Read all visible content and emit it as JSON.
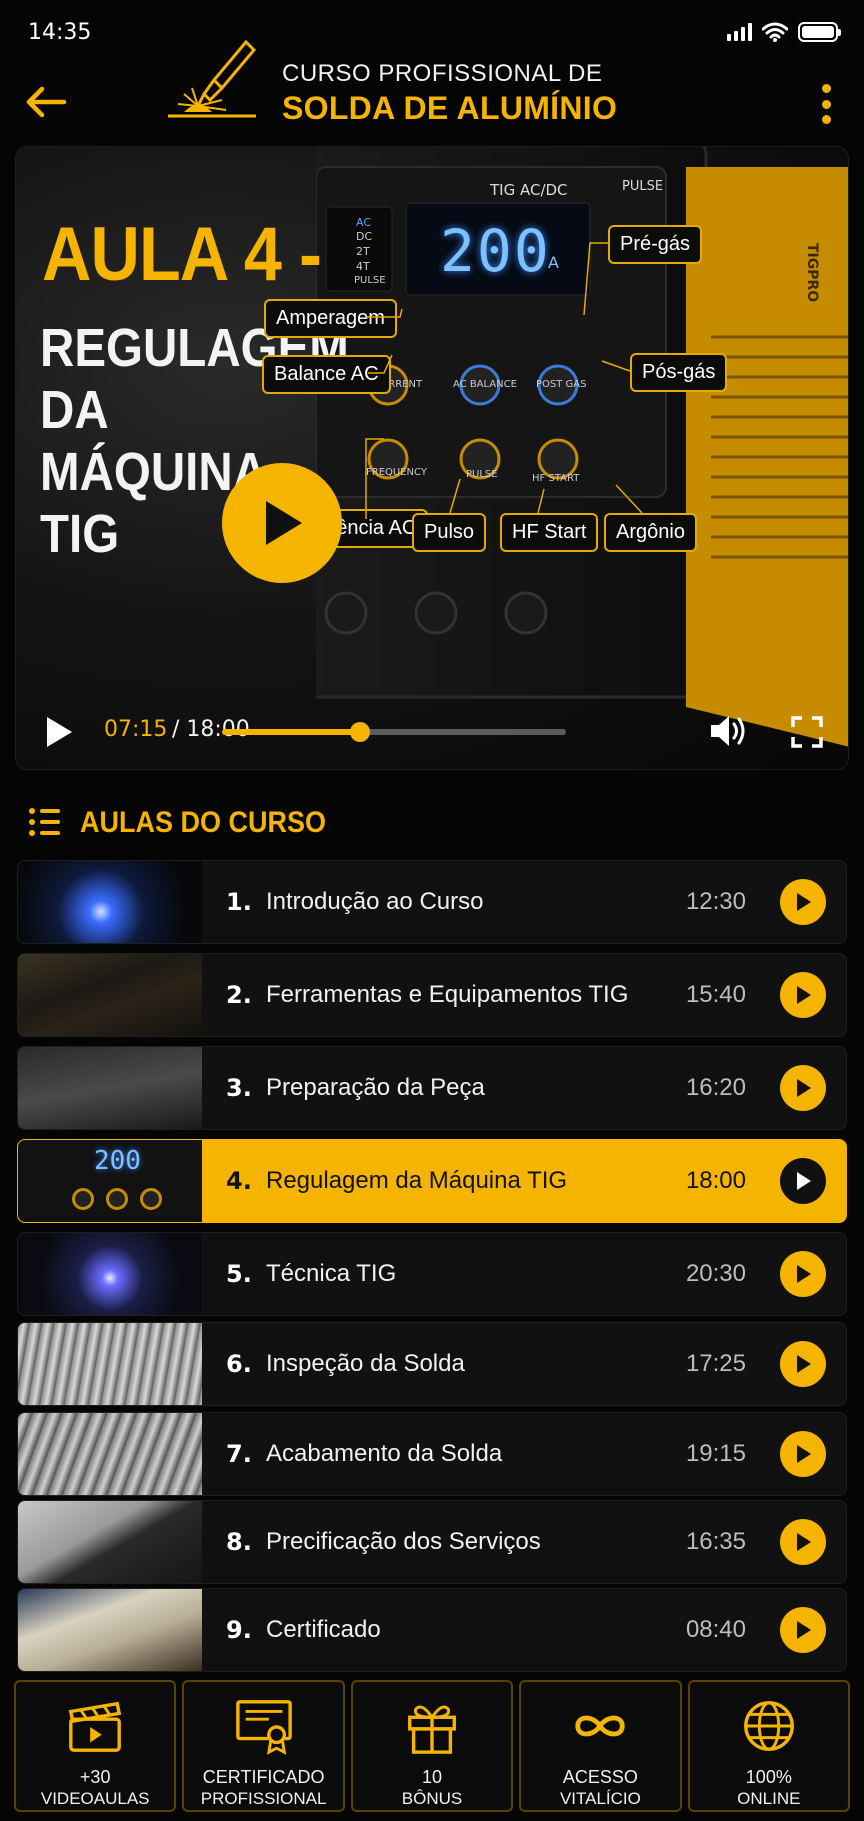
{
  "status_bar": {
    "time": "14:35"
  },
  "header": {
    "title_line1": "CURSO PROFISSIONAL DE",
    "title_line2": "SOLDA DE ALUMÍNIO",
    "back_icon": "arrow-left-icon",
    "menu_icon": "more-vertical-icon"
  },
  "video": {
    "lesson_heading": "AULA 4 -",
    "lesson_subtitle": "REGULAGEM DA MÁQUINA TIG",
    "current_time": "07:15",
    "total_time": "/ 18:00",
    "progress_percent": 40,
    "machine": {
      "mode_label": "TIG AC/DC",
      "pulse_label": "PULSE",
      "display_value": "200",
      "display_unit": "A",
      "left_panel": [
        "AC",
        "DC",
        "2T",
        "4T",
        "PULSE"
      ],
      "knobs": [
        "CURRENT",
        "AC BALANCE",
        "POST GAS",
        "FREQUENCY",
        "PULSE",
        "HF START"
      ],
      "brand": "TIGPRO"
    },
    "callouts": {
      "amperagem": "Amperagem",
      "balance_ac": "Balance AC",
      "pre_gas": "Pré-gás",
      "pos_gas": "Pós-gás",
      "frequencia_ac": "Frequência AC",
      "pulso": "Pulso",
      "hf_start": "HF Start",
      "argonio": "Argônio"
    }
  },
  "course_list": {
    "title": "AULAS DO CURSO",
    "lessons": [
      {
        "num": "1.",
        "title": "Introdução ao Curso",
        "duration": "12:30"
      },
      {
        "num": "2.",
        "title": "Ferramentas e Equipamentos TIG",
        "duration": "15:40"
      },
      {
        "num": "3.",
        "title": "Preparação da Peça",
        "duration": "16:20"
      },
      {
        "num": "4.",
        "title": "Regulagem da Máquina TIG",
        "duration": "18:00"
      },
      {
        "num": "5.",
        "title": "Técnica TIG",
        "duration": "20:30"
      },
      {
        "num": "6.",
        "title": "Inspeção da Solda",
        "duration": "17:25"
      },
      {
        "num": "7.",
        "title": "Acabamento da Solda",
        "duration": "19:15"
      },
      {
        "num": "8.",
        "title": "Precificação dos Serviços",
        "duration": "16:35"
      },
      {
        "num": "9.",
        "title": "Certificado",
        "duration": "08:40"
      }
    ],
    "active_index": 3
  },
  "features": [
    {
      "icon": "clapperboard-icon",
      "line1": "+30",
      "line2": "VIDEOAULAS"
    },
    {
      "icon": "certificate-icon",
      "line1": "CERTIFICADO",
      "line2": "PROFISSIONAL"
    },
    {
      "icon": "gift-icon",
      "line1": "10",
      "line2": "BÔNUS"
    },
    {
      "icon": "infinity-icon",
      "line1": "ACESSO",
      "line2": "VITALÍCIO"
    },
    {
      "icon": "globe-icon",
      "line1": "100%",
      "line2": "ONLINE"
    }
  ],
  "colors": {
    "accent": "#F5B400",
    "background": "#050505",
    "card": "#111111"
  }
}
